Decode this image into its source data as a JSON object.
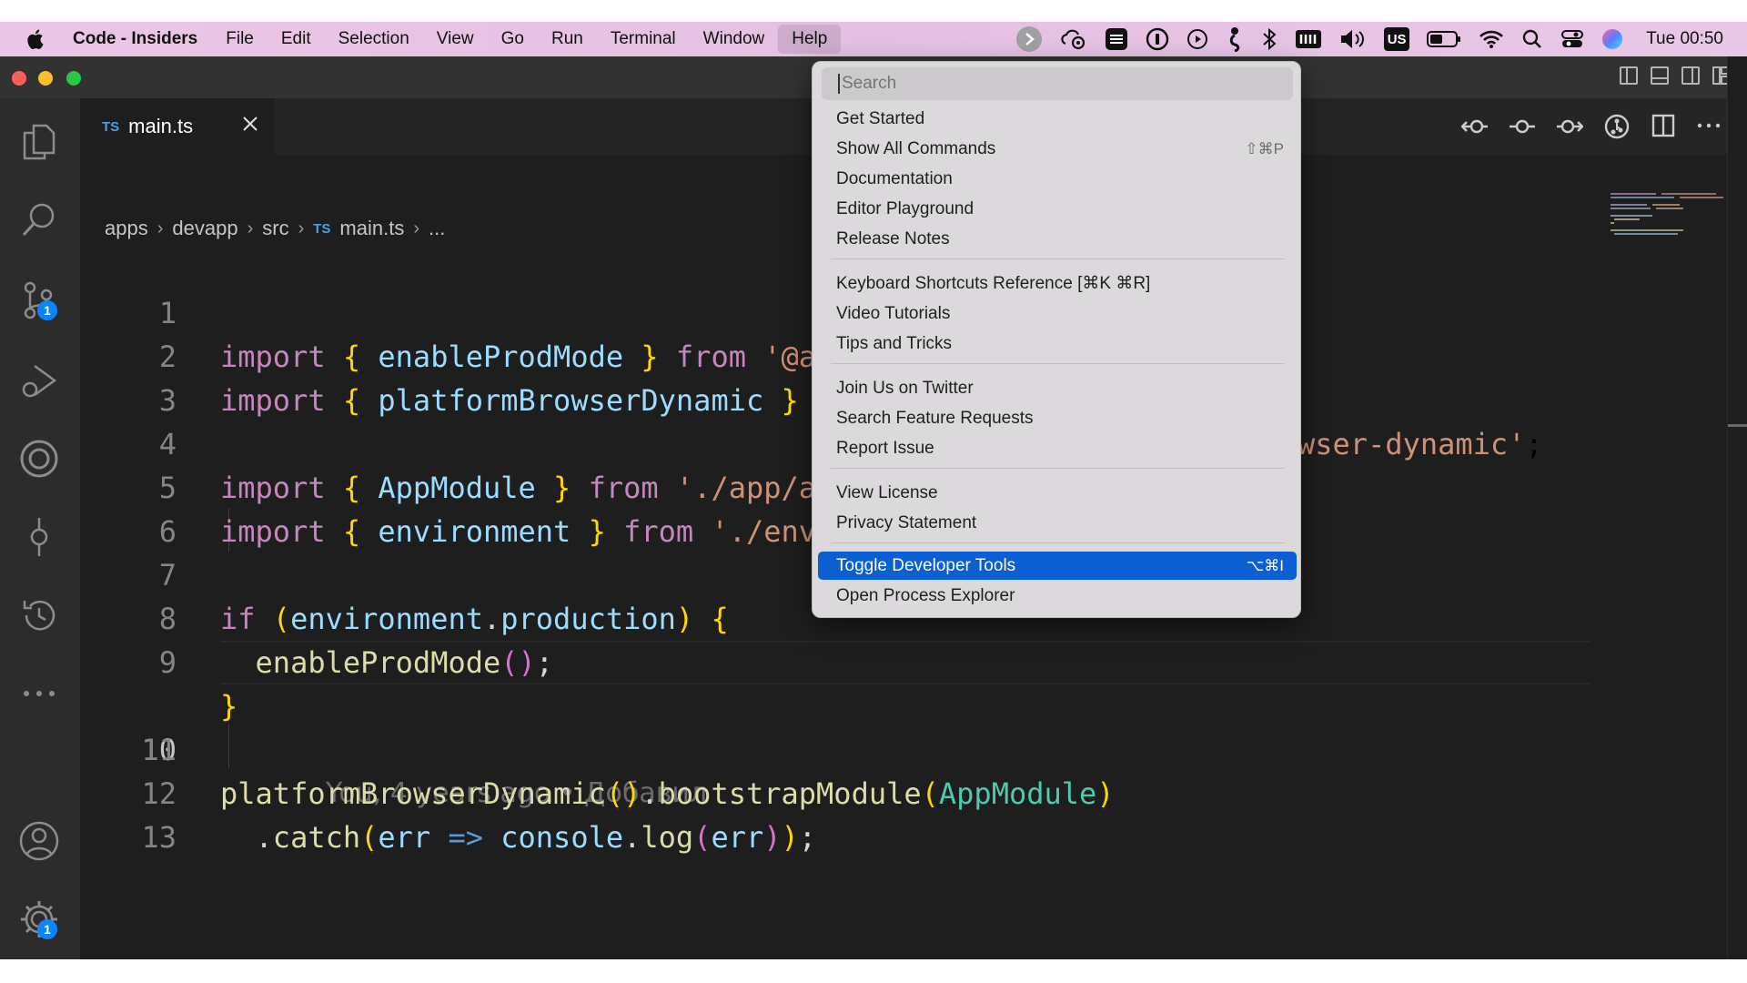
{
  "menubar": {
    "app_name": "Code - Insiders",
    "items": [
      "File",
      "Edit",
      "Selection",
      "View",
      "Go",
      "Run",
      "Terminal",
      "Window",
      "Help"
    ],
    "active_item": "Help",
    "input_source": "US",
    "clock": "Tue 00:50"
  },
  "tab": {
    "lang": "TS",
    "filename": "main.ts"
  },
  "breadcrumb": {
    "parts": [
      "apps",
      "devapp",
      "src"
    ],
    "lang": "TS",
    "file": "main.ts",
    "ellipsis": "..."
  },
  "editor": {
    "line_numbers": [
      "1",
      "2",
      "3",
      "4",
      "5",
      "6",
      "7",
      "8",
      "9",
      "10",
      "11",
      "12",
      "13"
    ],
    "current_line": "10",
    "blame": "You, 4 years ago • Добавил",
    "code": {
      "l1": {
        "kw": "import",
        "ob": "{",
        "name": "enableProdMode",
        "cb": "}",
        "from": "from",
        "str": "'@a"
      },
      "l2": {
        "kw": "import",
        "ob": "{",
        "name": "platformBrowserDynamic",
        "cb": "}",
        "str_tail": "wser-dynamic'",
        "semi": ";"
      },
      "l4": {
        "kw": "import",
        "ob": "{",
        "name": "AppModule",
        "cb": "}",
        "from": "from",
        "str": "'./app/a"
      },
      "l5": {
        "kw": "import",
        "ob": "{",
        "name": "environment",
        "cb": "}",
        "from": "from",
        "str": "'./env"
      },
      "l7": {
        "kw": "if",
        "op": "(",
        "obj": "environment",
        "dot": ".",
        "prop": "production",
        "cp": ")",
        "ob": "{"
      },
      "l8": {
        "fn": "enableProdMode",
        "args": "()",
        "semi": ";"
      },
      "l9": {
        "cb": "}"
      },
      "l11": {
        "fn": "platformBrowserDynamic",
        "p1": "()",
        "dot": ".",
        "fn2": "bootstrapModule",
        "op": "(",
        "cls": "AppModule",
        "cp": ")"
      },
      "l12": {
        "dot": ".",
        "fn": "catch",
        "op": "(",
        "arg": "err",
        "arrow": "=>",
        "obj": "console",
        "dot2": ".",
        "fn2": "log",
        "op2": "(",
        "arg2": "err",
        "cp2": ")",
        "cp": ")",
        "semi": ";"
      }
    }
  },
  "help_menu": {
    "search_placeholder": "Search",
    "groups": [
      [
        {
          "label": "Get Started",
          "shortcut": ""
        },
        {
          "label": "Show All Commands",
          "shortcut": "⇧⌘P"
        },
        {
          "label": "Documentation",
          "shortcut": ""
        },
        {
          "label": "Editor Playground",
          "shortcut": ""
        },
        {
          "label": "Release Notes",
          "shortcut": ""
        }
      ],
      [
        {
          "label": "Keyboard Shortcuts Reference [⌘K ⌘R]",
          "shortcut": ""
        },
        {
          "label": "Video Tutorials",
          "shortcut": ""
        },
        {
          "label": "Tips and Tricks",
          "shortcut": ""
        }
      ],
      [
        {
          "label": "Join Us on Twitter",
          "shortcut": ""
        },
        {
          "label": "Search Feature Requests",
          "shortcut": ""
        },
        {
          "label": "Report Issue",
          "shortcut": ""
        }
      ],
      [
        {
          "label": "View License",
          "shortcut": ""
        },
        {
          "label": "Privacy Statement",
          "shortcut": ""
        }
      ],
      [
        {
          "label": "Toggle Developer Tools",
          "shortcut": "⌥⌘I"
        },
        {
          "label": "Open Process Explorer",
          "shortcut": ""
        }
      ]
    ],
    "highlighted": "Toggle Developer Tools"
  },
  "badges": {
    "source_control": "1",
    "settings": "1"
  },
  "colors": {
    "accent": "#0a5fd3",
    "badge": "#0a84ff",
    "menubar_bg": "#e6c3e4",
    "editor_bg": "#1e1e1e"
  }
}
